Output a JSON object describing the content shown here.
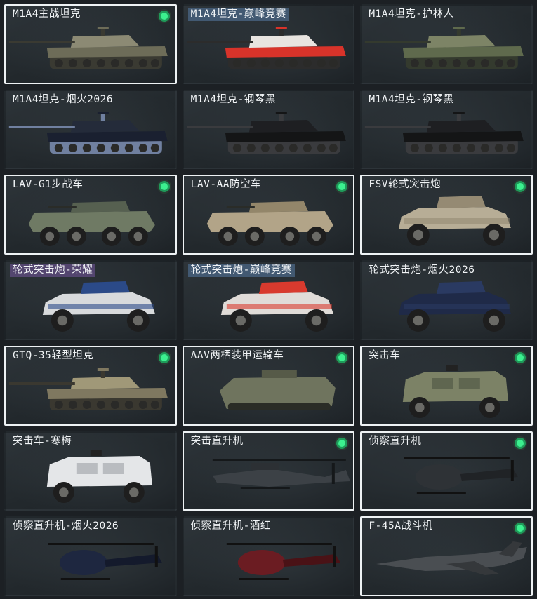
{
  "colors": {
    "background": "#1c2024",
    "card": "#2a3035",
    "selected_border": "#eef2f4",
    "badge_green": "#3cf08f",
    "label_tag_blue": "#46607c",
    "label_tag_purple": "#584876"
  },
  "cards": [
    {
      "label": "M1A4主战坦克",
      "selected": true,
      "badge": true,
      "tag": "",
      "icon": "tank-icon",
      "type": "tank",
      "palette": [
        "#8c8a74",
        "#6d6c58",
        "#3a3a32"
      ]
    },
    {
      "label": "M1A4坦克-巅峰竞赛",
      "selected": false,
      "badge": false,
      "tag": "blue",
      "icon": "tank-icon",
      "type": "tank",
      "palette": [
        "#e8e4e0",
        "#d8332a",
        "#2c2c2c"
      ]
    },
    {
      "label": "M1A4坦克-护林人",
      "selected": false,
      "badge": false,
      "tag": "",
      "icon": "tank-icon",
      "type": "tank",
      "palette": [
        "#7d8466",
        "#5f6a4d",
        "#343a2e"
      ]
    },
    {
      "label": "M1A4坦克-烟火2026",
      "selected": false,
      "badge": false,
      "tag": "",
      "icon": "tank-icon",
      "type": "tank",
      "palette": [
        "#242b3a",
        "#1a2030",
        "#7080a0"
      ]
    },
    {
      "label": "M1A4坦克-钢琴黑",
      "selected": false,
      "badge": false,
      "tag": "",
      "icon": "tank-icon",
      "type": "tank",
      "palette": [
        "#1e1f22",
        "#141516",
        "#3a3b3e"
      ]
    },
    {
      "label": "M1A4坦克-钢琴黑",
      "selected": false,
      "badge": false,
      "tag": "",
      "icon": "tank-icon",
      "type": "tank",
      "palette": [
        "#1e1f22",
        "#141516",
        "#3a3b3e"
      ]
    },
    {
      "label": "LAV-G1步战车",
      "selected": true,
      "badge": true,
      "tag": "",
      "icon": "apc-icon",
      "type": "apc",
      "palette": [
        "#6f7a64",
        "#566050",
        "#2a2c28"
      ]
    },
    {
      "label": "LAV-AA防空车",
      "selected": true,
      "badge": true,
      "tag": "",
      "icon": "apc-icon",
      "type": "apc",
      "palette": [
        "#b2a488",
        "#93866a",
        "#2a2c28"
      ]
    },
    {
      "label": "FSV轮式突击炮",
      "selected": true,
      "badge": true,
      "tag": "",
      "icon": "armored-car-icon",
      "type": "car",
      "palette": [
        "#b7ad96",
        "#958a73",
        "#2a2c28"
      ]
    },
    {
      "label": "轮式突击炮-荣耀",
      "selected": false,
      "badge": false,
      "tag": "purple",
      "icon": "armored-car-icon",
      "type": "car",
      "palette": [
        "#d8dadc",
        "#2b4a88",
        "#222"
      ]
    },
    {
      "label": "轮式突击炮-巅峰竞赛",
      "selected": false,
      "badge": false,
      "tag": "blue",
      "icon": "armored-car-icon",
      "type": "car",
      "palette": [
        "#e0dcd8",
        "#d83a2e",
        "#222"
      ]
    },
    {
      "label": "轮式突击炮-烟火2026",
      "selected": false,
      "badge": false,
      "tag": "",
      "icon": "armored-car-icon",
      "type": "car",
      "palette": [
        "#1f2a48",
        "#2a3a62",
        "#222"
      ]
    },
    {
      "label": "GTQ-35轻型坦克",
      "selected": true,
      "badge": true,
      "tag": "",
      "icon": "light-tank-icon",
      "type": "tank",
      "palette": [
        "#a09878",
        "#7f7860",
        "#3a3830"
      ]
    },
    {
      "label": "AAV两栖装甲运输车",
      "selected": true,
      "badge": true,
      "tag": "",
      "icon": "amphibious-icon",
      "type": "aav",
      "palette": [
        "#6f745e",
        "#565a48",
        "#2a2c26"
      ]
    },
    {
      "label": "突击车",
      "selected": true,
      "badge": true,
      "tag": "",
      "icon": "mrap-icon",
      "type": "mrap",
      "palette": [
        "#7c8266",
        "#5f6650",
        "#222"
      ]
    },
    {
      "label": "突击车-寒梅",
      "selected": false,
      "badge": false,
      "tag": "",
      "icon": "mrap-icon",
      "type": "mrap",
      "palette": [
        "#e4e6e8",
        "#b9bcc0",
        "#222"
      ]
    },
    {
      "label": "突击直升机",
      "selected": true,
      "badge": true,
      "tag": "",
      "icon": "helicopter-icon",
      "type": "heli-attack",
      "palette": [
        "#3c4146",
        "#2c3034",
        "#15181a"
      ]
    },
    {
      "label": "侦察直升机",
      "selected": true,
      "badge": true,
      "tag": "",
      "icon": "helicopter-icon",
      "type": "heli-scout",
      "palette": [
        "#2e3236",
        "#202326",
        "#111"
      ]
    },
    {
      "label": "侦察直升机-烟火2026",
      "selected": false,
      "badge": false,
      "tag": "",
      "icon": "helicopter-icon",
      "type": "heli-scout",
      "palette": [
        "#1e2740",
        "#141a2c",
        "#111"
      ]
    },
    {
      "label": "侦察直升机-酒红",
      "selected": false,
      "badge": false,
      "tag": "",
      "icon": "helicopter-icon",
      "type": "heli-scout",
      "palette": [
        "#6b1c22",
        "#4a1216",
        "#111"
      ]
    },
    {
      "label": "F-45A战斗机",
      "selected": true,
      "badge": true,
      "tag": "",
      "icon": "jet-icon",
      "type": "jet",
      "palette": [
        "#4a4e52",
        "#35383b",
        "#1c1e20"
      ]
    }
  ]
}
